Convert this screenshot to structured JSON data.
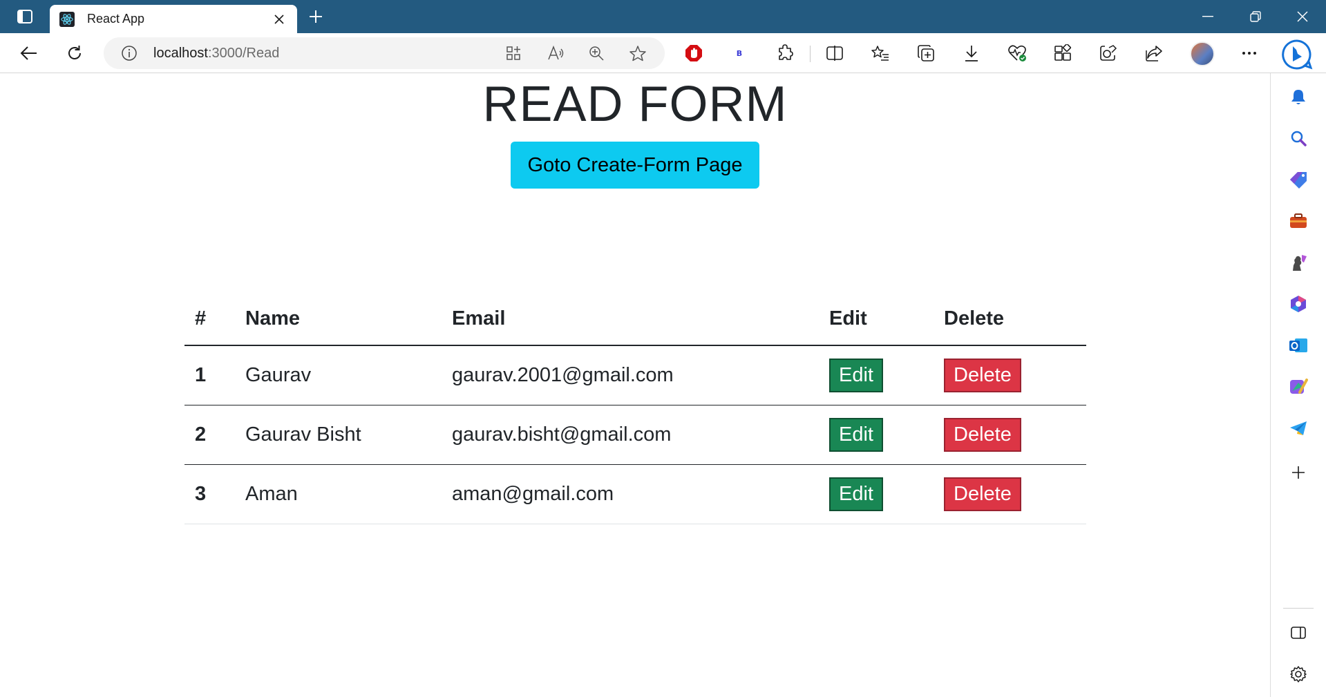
{
  "browser": {
    "tab_title": "React App",
    "url_host": "localhost",
    "url_path": ":3000/Read",
    "accent": "#235a80"
  },
  "page": {
    "heading": "READ FORM",
    "create_button_label": "Goto Create-Form Page",
    "table": {
      "headers": [
        "#",
        "Name",
        "Email",
        "Edit",
        "Delete"
      ],
      "rows": [
        {
          "num": "1",
          "name": "Gaurav",
          "email": "gaurav.2001@gmail.com",
          "edit": "Edit",
          "delete": "Delete"
        },
        {
          "num": "2",
          "name": "Gaurav Bisht",
          "email": "gaurav.bisht@gmail.com",
          "edit": "Edit",
          "delete": "Delete"
        },
        {
          "num": "3",
          "name": "Aman",
          "email": "aman@gmail.com",
          "edit": "Edit",
          "delete": "Delete"
        }
      ]
    },
    "colors": {
      "create_button": "#0dcaf0",
      "edit_button": "#198754",
      "delete_button": "#dc3545"
    }
  },
  "icons": {
    "titlebar": [
      "tab-actions-icon",
      "react-icon",
      "close-icon",
      "plus-icon",
      "minimize-icon",
      "restore-icon",
      "window-close-icon"
    ],
    "toolbar": [
      "back-icon",
      "refresh-icon",
      "info-icon",
      "app-available-icon",
      "read-aloud-icon",
      "zoom-icon",
      "favorite-star-icon",
      "adblock-icon",
      "extension-b-icon",
      "extensions-icon",
      "split-screen-icon",
      "favorites-icon",
      "collections-icon",
      "downloads-icon",
      "browser-essentials-icon",
      "apps-icon",
      "screenshot-icon",
      "share-icon",
      "avatar",
      "more-icon",
      "copilot-icon"
    ],
    "sidebar": [
      "bell-icon",
      "search-icon",
      "shopping-icon",
      "tools-icon",
      "games-icon",
      "microsoft365-icon",
      "outlook-icon",
      "designer-icon",
      "telegram-icon",
      "add-icon",
      "sidebar-toggle-icon",
      "settings-icon"
    ]
  }
}
